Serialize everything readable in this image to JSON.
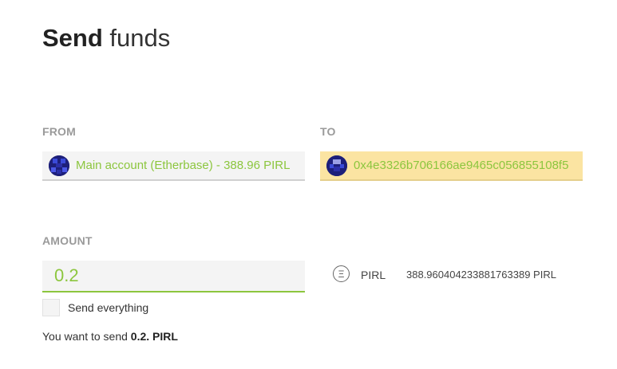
{
  "title": {
    "strong": "Send",
    "light": "funds"
  },
  "from": {
    "label": "FROM",
    "selected": "Main account (Etherbase) - 388.96 PIRL",
    "icon": "identicon"
  },
  "to": {
    "label": "TO",
    "address": "0x4e3326b706166ae9465c056855108f5",
    "icon": "identicon",
    "highlight_color": "#fbe4a2"
  },
  "amount": {
    "label": "AMOUNT",
    "value": "0.2",
    "send_everything_label": "Send everything",
    "send_everything_checked": false
  },
  "summary": {
    "prefix": "You want to send",
    "amount": "0.2.",
    "unit": "PIRL"
  },
  "token": {
    "icon": "ether-icon",
    "icon_glyph": "Ξ",
    "name": "PIRL",
    "balance": "388.960404233881763389 PIRL"
  },
  "colors": {
    "accent": "#8cc63e",
    "label": "#9a9a9a"
  }
}
